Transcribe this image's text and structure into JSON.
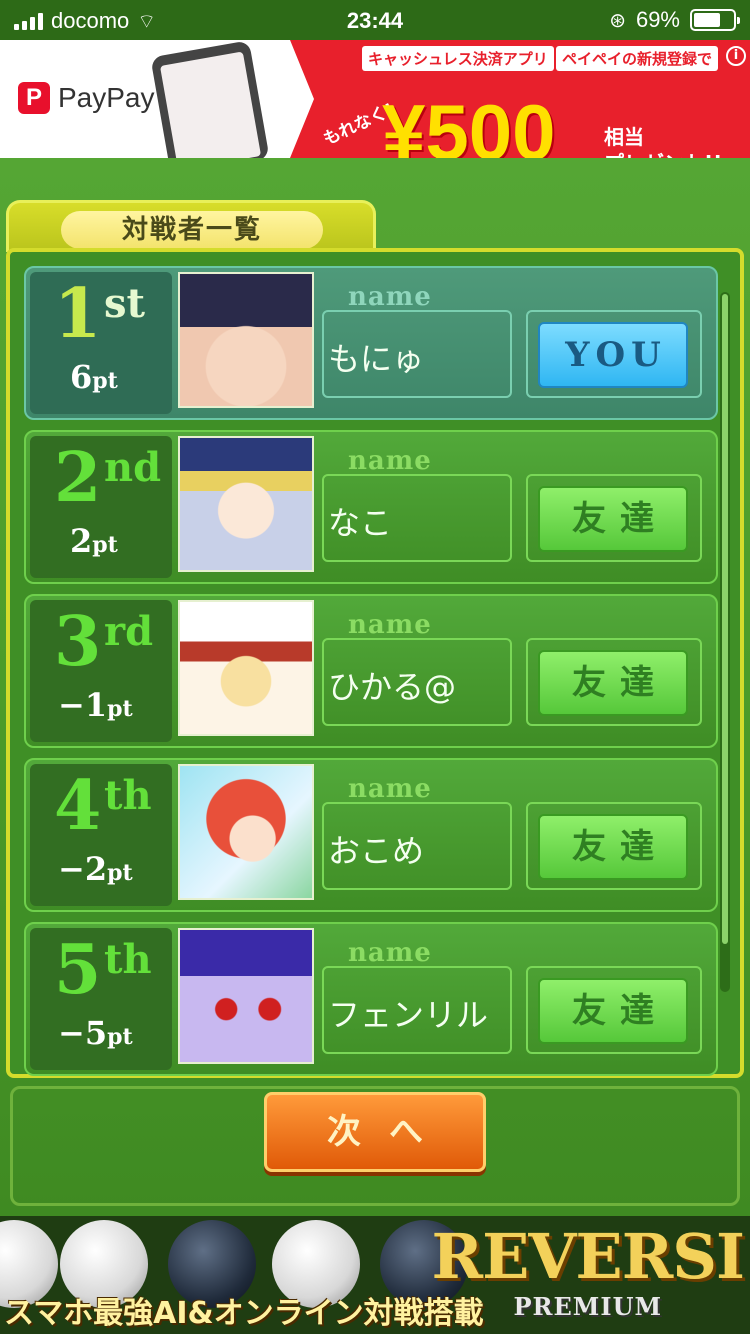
{
  "status_bar": {
    "carrier": "docomo",
    "time": "23:44",
    "battery": "69%",
    "battery_level": 0.69
  },
  "ad_banner": {
    "brand": "PayPay",
    "tag_left": "キャッシュレス決済アプリ",
    "tag_right": "ペイペイの新規登録で",
    "sub": "もれなく!",
    "amount": "¥500",
    "gift_line1": "相当",
    "gift_line2": "プレゼント!!",
    "info": "i"
  },
  "board": {
    "title": "対戦者一覧",
    "name_label": "name",
    "rows": [
      {
        "rank": "1",
        "suffix": "st",
        "points": "6",
        "unit": "pt",
        "name": "もにゅ",
        "button": "YOU"
      },
      {
        "rank": "2",
        "suffix": "nd",
        "points": "2",
        "unit": "pt",
        "name": "なこ",
        "button": "友達"
      },
      {
        "rank": "3",
        "suffix": "rd",
        "points": "−1",
        "unit": "pt",
        "name": "ひかる@",
        "button": "友達"
      },
      {
        "rank": "4",
        "suffix": "th",
        "points": "−2",
        "unit": "pt",
        "name": "おこめ",
        "button": "友達"
      },
      {
        "rank": "5",
        "suffix": "th",
        "points": "−5",
        "unit": "pt",
        "name": "フェンリル",
        "button": "友達"
      }
    ],
    "next_button": "次へ"
  },
  "bottom_banner": {
    "tagline": "スマホ最強AI&オンライン対戦搭載",
    "logo_big": "REVERSI",
    "logo_small": "PREMIUM"
  }
}
